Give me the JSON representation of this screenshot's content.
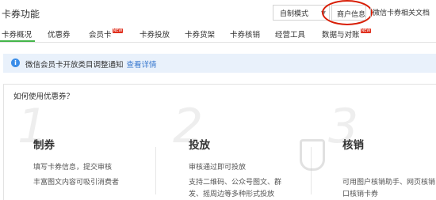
{
  "header": {
    "title": "卡券功能",
    "mode_select": "自制模式",
    "merchant_button": "商户信息",
    "doc_link": "微信卡券相关文档"
  },
  "tabs": [
    {
      "label": "卡券概况",
      "active": true,
      "new": false
    },
    {
      "label": "优惠券",
      "active": false,
      "new": false
    },
    {
      "label": "会员卡",
      "active": false,
      "new": true
    },
    {
      "label": "卡券投放",
      "active": false,
      "new": false
    },
    {
      "label": "卡券货架",
      "active": false,
      "new": false
    },
    {
      "label": "卡券核销",
      "active": false,
      "new": false
    },
    {
      "label": "经营工具",
      "active": false,
      "new": false
    },
    {
      "label": "数据与对账",
      "active": false,
      "new": true
    }
  ],
  "new_badge": "NEW",
  "notice": {
    "icon": "info-icon",
    "text": "微信会员卡开放类目调整通知",
    "link": "查看详情"
  },
  "howto": {
    "title": "如何使用优惠券？",
    "steps": [
      {
        "number": "1",
        "title": "制券",
        "lines": [
          "填写卡券信息，提交审核",
          "丰富图文内容可吸引消费者"
        ]
      },
      {
        "number": "2",
        "title": "投放",
        "lines": [
          "审核通过即可投放",
          "支持二维码、公众号图文、群",
          "发、摇周边等多种形式投放"
        ]
      },
      {
        "number": "3",
        "title": "核销",
        "lines": [
          "可用图户核销助手、网页核销",
          "口核销卡券"
        ]
      }
    ]
  },
  "colors": {
    "accent_green": "#44b549",
    "link_blue": "#3576ce",
    "badge_red": "#e0301e",
    "annotation_red": "#d81e06",
    "notice_bg": "#e9f1fb"
  }
}
